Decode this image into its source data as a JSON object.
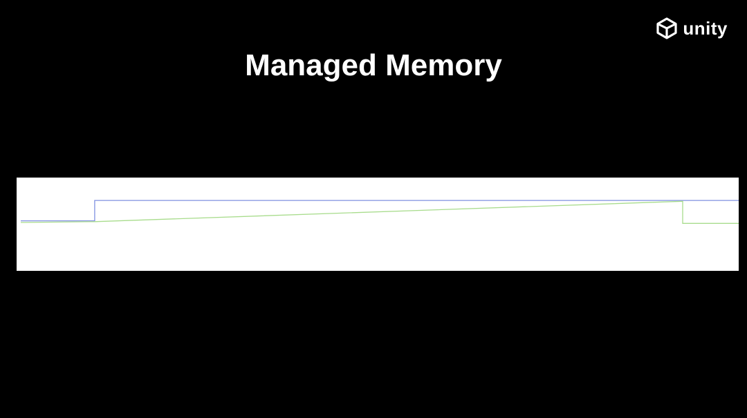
{
  "slide": {
    "title": "Managed Memory"
  },
  "logo": {
    "text": "unity",
    "icon": "unity-cube-icon"
  },
  "colors": {
    "background": "#000000",
    "panel": "#ffffff",
    "reserved": "#7f8fe0",
    "used": "#a8dc8c"
  },
  "chart_data": {
    "type": "line",
    "title": "",
    "xlabel": "",
    "ylabel": "",
    "xlim": [
      0,
      100
    ],
    "ylim": [
      0,
      100
    ],
    "grid": false,
    "legend": "none",
    "series": [
      {
        "color": "#7f8fe0",
        "x": [
          0,
          10.3,
          10.3,
          100
        ],
        "y": [
          54,
          54,
          78,
          78
        ]
      },
      {
        "color": "#a8dc8c",
        "x": [
          0,
          10.3,
          92.2,
          92.2,
          100
        ],
        "y": [
          52,
          53,
          77,
          51,
          51
        ]
      }
    ]
  }
}
